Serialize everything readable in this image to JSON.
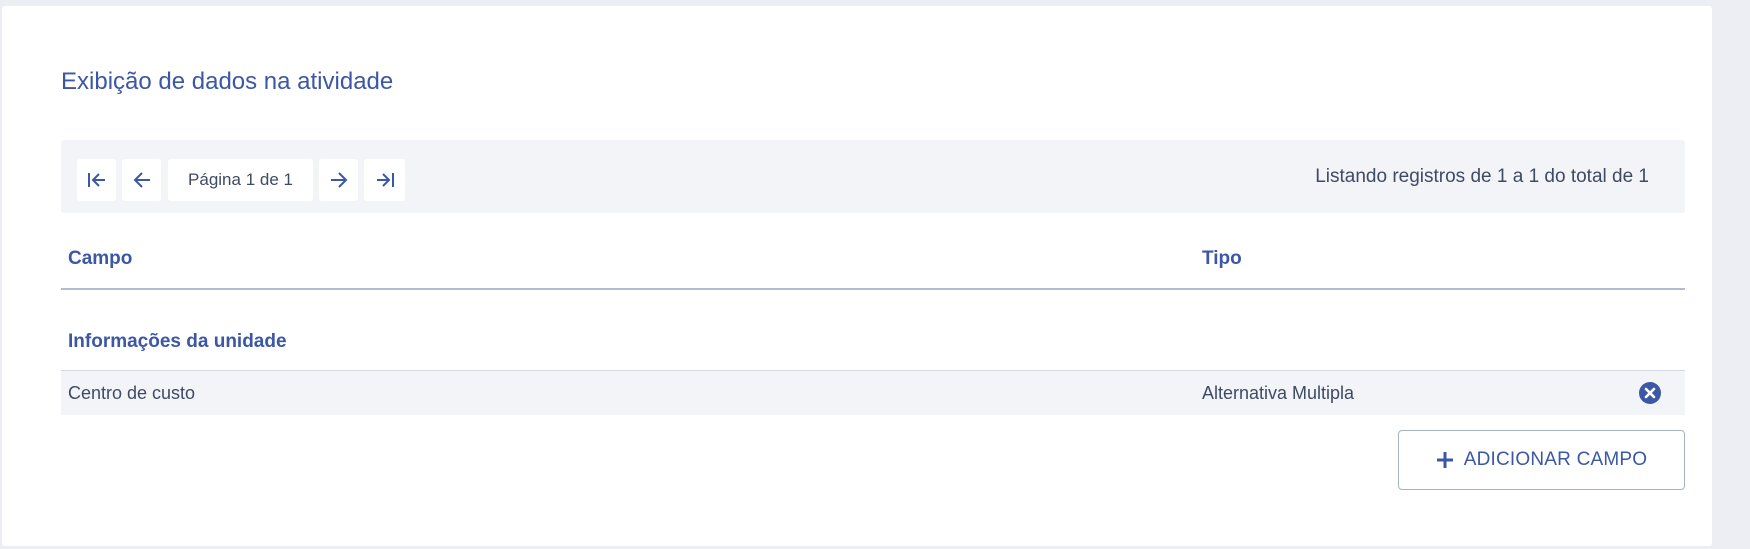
{
  "section": {
    "title": "Exibição de dados na atividade"
  },
  "pagination": {
    "page_label": "Página 1 de 1",
    "records_label": "Listando registros de 1 a 1 do total de 1",
    "icons": {
      "first": "first-page-icon",
      "prev": "arrow-left-icon",
      "next": "arrow-right-icon",
      "last": "last-page-icon"
    }
  },
  "table": {
    "columns": [
      "Campo",
      "Tipo"
    ],
    "groups": [
      {
        "title": "Informações da unidade",
        "rows": [
          {
            "campo": "Centro de custo",
            "tipo": "Alternativa Multipla",
            "action_icon": "remove-circle-icon"
          }
        ]
      }
    ]
  },
  "actions": {
    "add_field_label": "ADICIONAR CAMPO",
    "add_field_icon": "plus-icon"
  },
  "colors": {
    "accent": "#3b57a6",
    "text": "#3f4a63",
    "surface": "#f3f4f8",
    "page_background": "#eceef3"
  }
}
